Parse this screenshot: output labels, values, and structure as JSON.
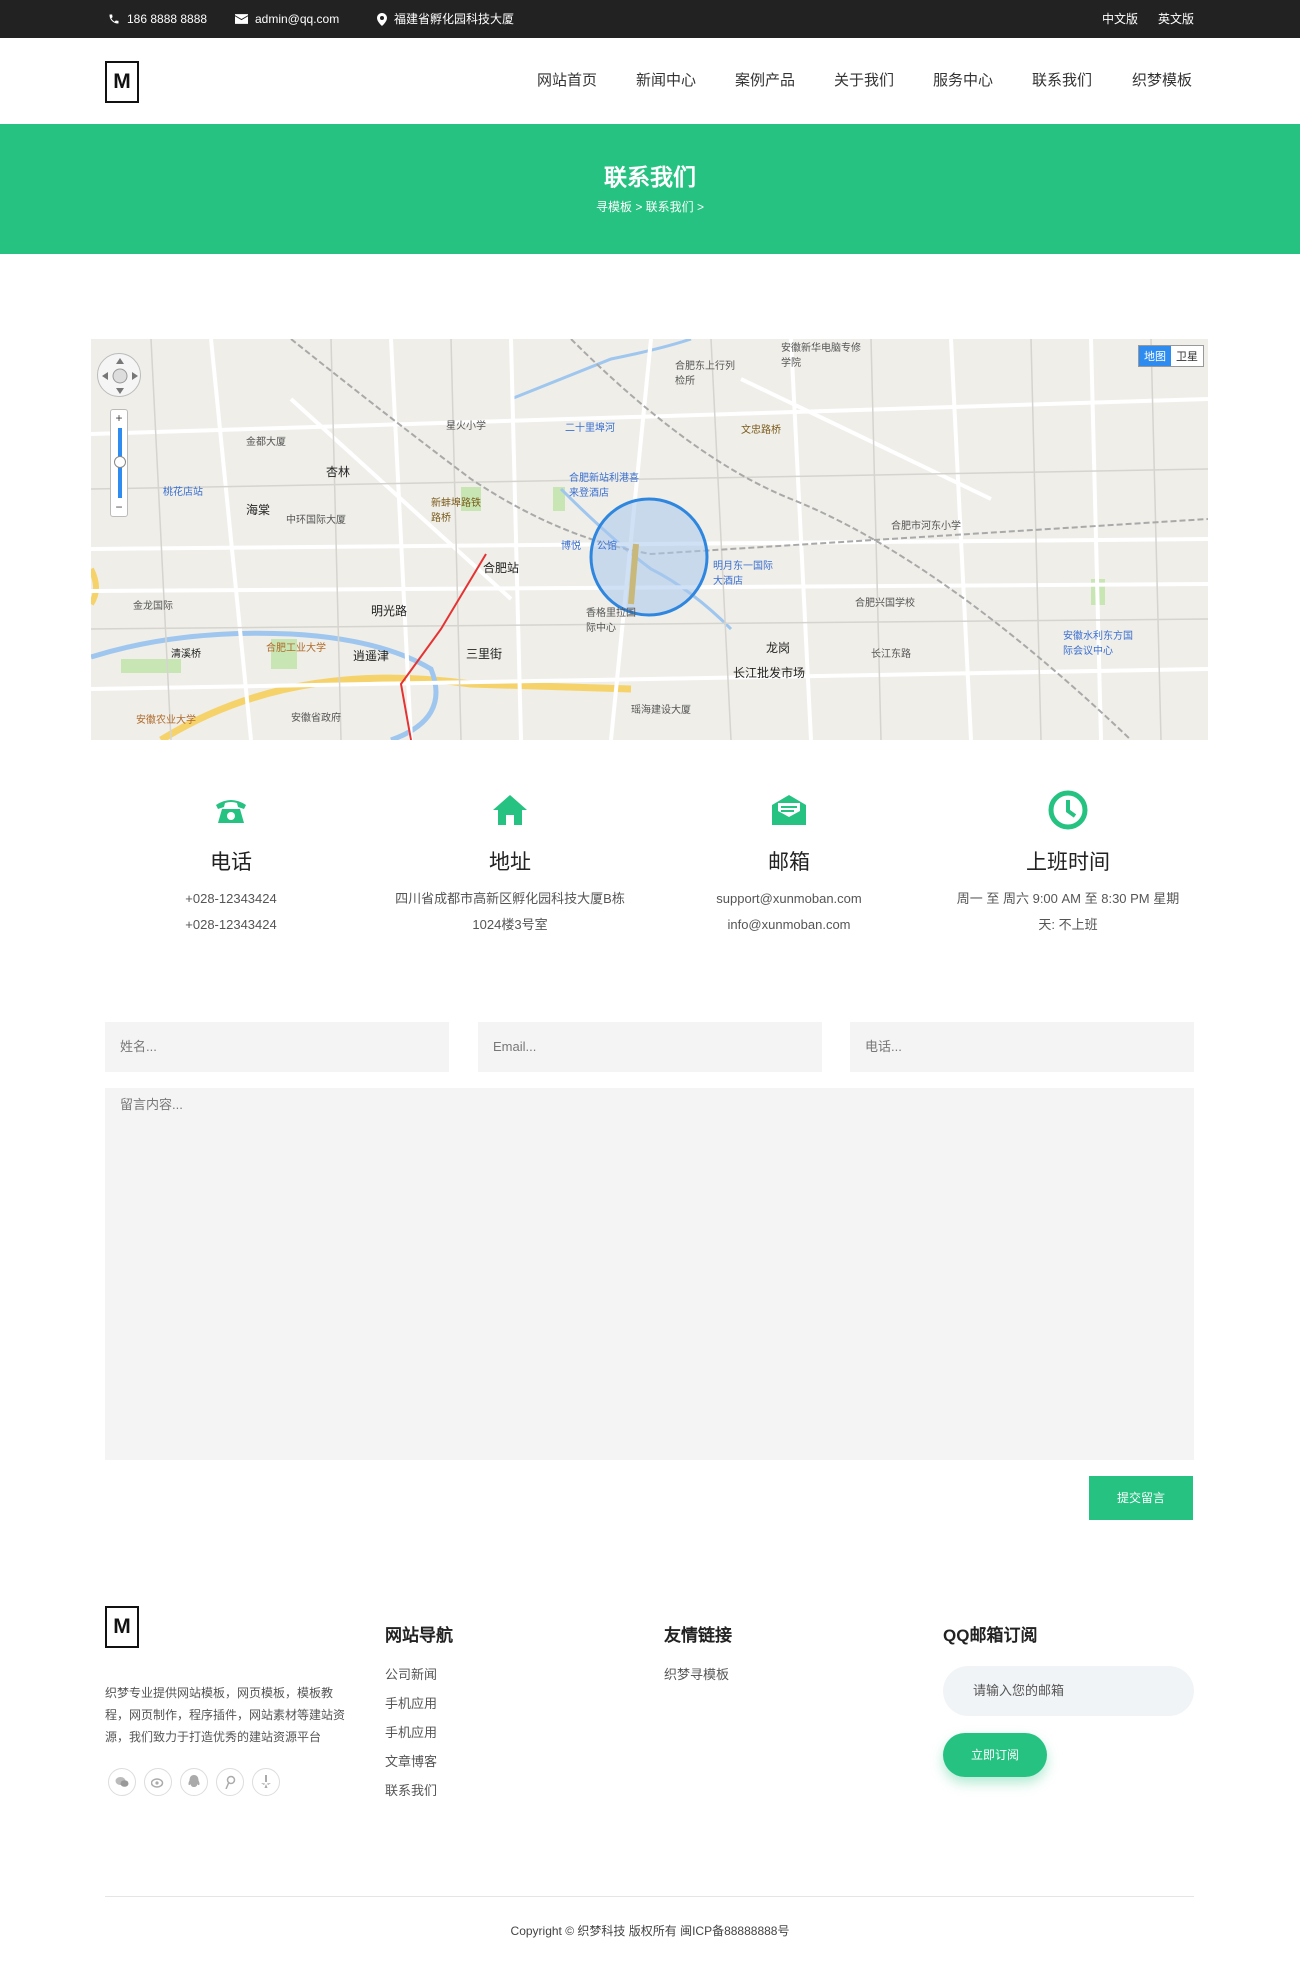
{
  "topbar": {
    "phone": "186 8888 8888",
    "email": "admin@qq.com",
    "address": "福建省孵化园科技大厦",
    "lang_cn": "中文版",
    "lang_en": "英文版"
  },
  "header": {
    "logo": "M",
    "nav": [
      "网站首页",
      "新闻中心",
      "案例产品",
      "关于我们",
      "服务中心",
      "联系我们",
      "织梦模板"
    ]
  },
  "banner": {
    "title": "联系我们",
    "breadcrumb": "寻模板 > 联系我们 >"
  },
  "map": {
    "type_map": "地图",
    "type_satellite": "卫星",
    "labels": {
      "l1": "合肥站",
      "l2": "桃花店站",
      "l3": "海棠",
      "l4": "杏林",
      "l5": "明光路",
      "l6": "三里街",
      "l7": "逍遥津",
      "l8": "龙岗",
      "l9": "长江批发市场",
      "l10": "合肥工业大学",
      "l11": "安徽农业大学",
      "l12": "安徽省政府",
      "l13": "合肥新站利港喜来登酒店",
      "l14": "明月东一国际大酒店",
      "l15": "合肥兴国学校",
      "l16": "合肥市河东小学",
      "l17": "文忠路桥",
      "l18": "新蚌埠路铁路桥",
      "l19": "安徽水利东方国际会议中心",
      "l20": "香格里拉国际中心",
      "l21": "星火小学",
      "l22": "清溪桥",
      "l23": "金都大厦",
      "l24": "瑶海建设大厦",
      "l25": "长江东路",
      "l26": "公馆",
      "l27": "博悦",
      "l28": "安徽新华电脑专修学院",
      "l29": "合肥东上行列检所",
      "l30": "二十里埠河",
      "l31": "中环国际大厦",
      "l32": "金龙国际"
    }
  },
  "contact": [
    {
      "title": "电话",
      "line1": "+028-12343424",
      "line2": "+028-12343424"
    },
    {
      "title": "地址",
      "line1": "四川省成都市高新区孵化园科技大厦B栋",
      "line2": "1024楼3号室"
    },
    {
      "title": "邮箱",
      "line1": "support@xunmoban.com",
      "line2": "info@xunmoban.com"
    },
    {
      "title": "上班时间",
      "line1": "周一 至 周六 9:00 AM 至 8:30 PM 星期",
      "line2": "天: 不上班"
    }
  ],
  "form": {
    "name_placeholder": "姓名...",
    "email_placeholder": "Email...",
    "phone_placeholder": "电话...",
    "message_placeholder": "留言内容...",
    "submit": "提交留言"
  },
  "footer": {
    "logo": "M",
    "about": "织梦专业提供网站模板，网页模板，模板教程，网页制作，程序插件，网站素材等建站资源，我们致力于打造优秀的建站资源平台",
    "nav_title": "网站导航",
    "nav_links": [
      "公司新闻",
      "手机应用",
      "手机应用",
      "文章博客",
      "联系我们"
    ],
    "links_title": "友情链接",
    "links": [
      "织梦寻模板"
    ],
    "subscribe_title": "QQ邮箱订阅",
    "subscribe_placeholder": "请输入您的邮箱",
    "subscribe_button": "立即订阅",
    "social_icons": [
      "wechat-icon",
      "weibo-icon",
      "qq-icon",
      "tencent-weibo-icon",
      "yelp-icon"
    ],
    "copyright": "Copyright © 织梦科技 版权所有  闽ICP备88888888号"
  },
  "colors": {
    "accent": "#26c281",
    "topbar": "#222222",
    "field_bg": "#f4f4f4"
  }
}
